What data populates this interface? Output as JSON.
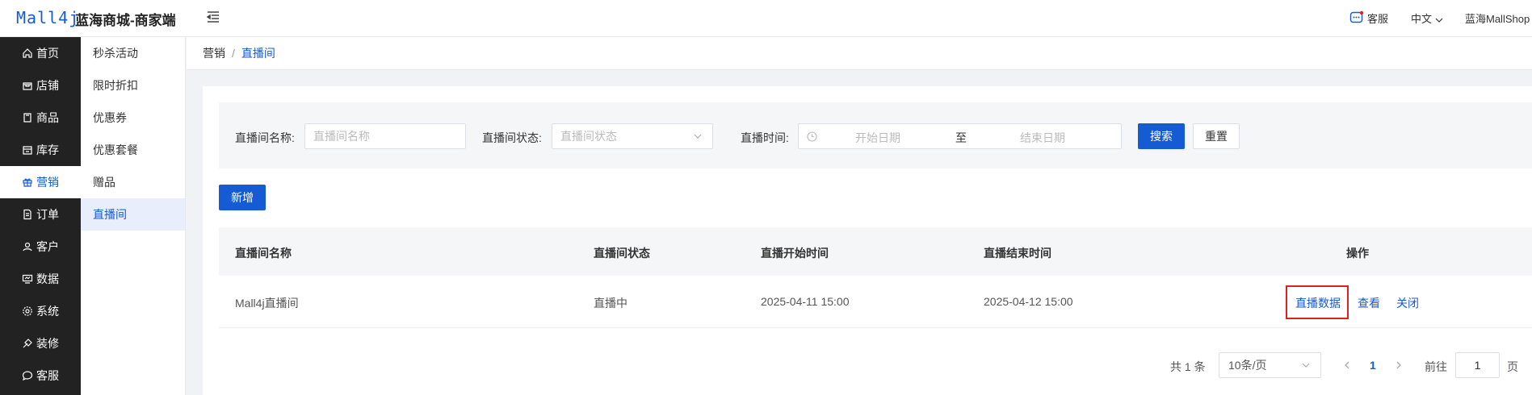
{
  "header": {
    "logo": "Mall4j",
    "brand": "蓝海商城-商家端",
    "service_label": "客服",
    "language": "中文",
    "user": "蓝海MallShop"
  },
  "sidebar": {
    "items": [
      {
        "label": "首页",
        "icon": "home-icon"
      },
      {
        "label": "店铺",
        "icon": "shop-icon"
      },
      {
        "label": "商品",
        "icon": "product-icon"
      },
      {
        "label": "库存",
        "icon": "inventory-icon"
      },
      {
        "label": "营销",
        "icon": "gift-icon",
        "active": true
      },
      {
        "label": "订单",
        "icon": "order-icon"
      },
      {
        "label": "客户",
        "icon": "customer-icon"
      },
      {
        "label": "数据",
        "icon": "data-icon"
      },
      {
        "label": "系统",
        "icon": "system-icon"
      },
      {
        "label": "装修",
        "icon": "decorate-icon"
      },
      {
        "label": "客服",
        "icon": "chat-icon"
      }
    ]
  },
  "subnav": {
    "items": [
      {
        "label": "秒杀活动"
      },
      {
        "label": "限时折扣"
      },
      {
        "label": "优惠券"
      },
      {
        "label": "优惠套餐"
      },
      {
        "label": "赠品"
      },
      {
        "label": "直播间",
        "active": true
      }
    ]
  },
  "breadcrumb": {
    "parent": "营销",
    "separator": "/",
    "current": "直播间"
  },
  "search": {
    "name_label": "直播间名称:",
    "name_placeholder": "直播间名称",
    "status_label": "直播间状态:",
    "status_placeholder": "直播间状态",
    "time_label": "直播时间:",
    "start_placeholder": "开始日期",
    "range_sep": "至",
    "end_placeholder": "结束日期",
    "search_button": "搜索",
    "reset_button": "重置"
  },
  "toolbar": {
    "add_button": "新增"
  },
  "table": {
    "columns": [
      "直播间名称",
      "直播间状态",
      "直播开始时间",
      "直播结束时间",
      "操作"
    ],
    "rows": [
      {
        "name": "Mall4j直播间",
        "status": "直播中",
        "start": "2025-04-11 15:00",
        "end": "2025-04-12 15:00",
        "actions": [
          "直播数据",
          "查看",
          "关闭"
        ]
      }
    ]
  },
  "pagination": {
    "total": "共 1 条",
    "page_size": "10条/页",
    "current_page": "1",
    "goto_label": "前往",
    "goto_value": "1",
    "page_suffix": "页"
  },
  "colors": {
    "primary": "#155bd4",
    "sidebar_bg": "#222222",
    "highlight": "#e02020"
  }
}
